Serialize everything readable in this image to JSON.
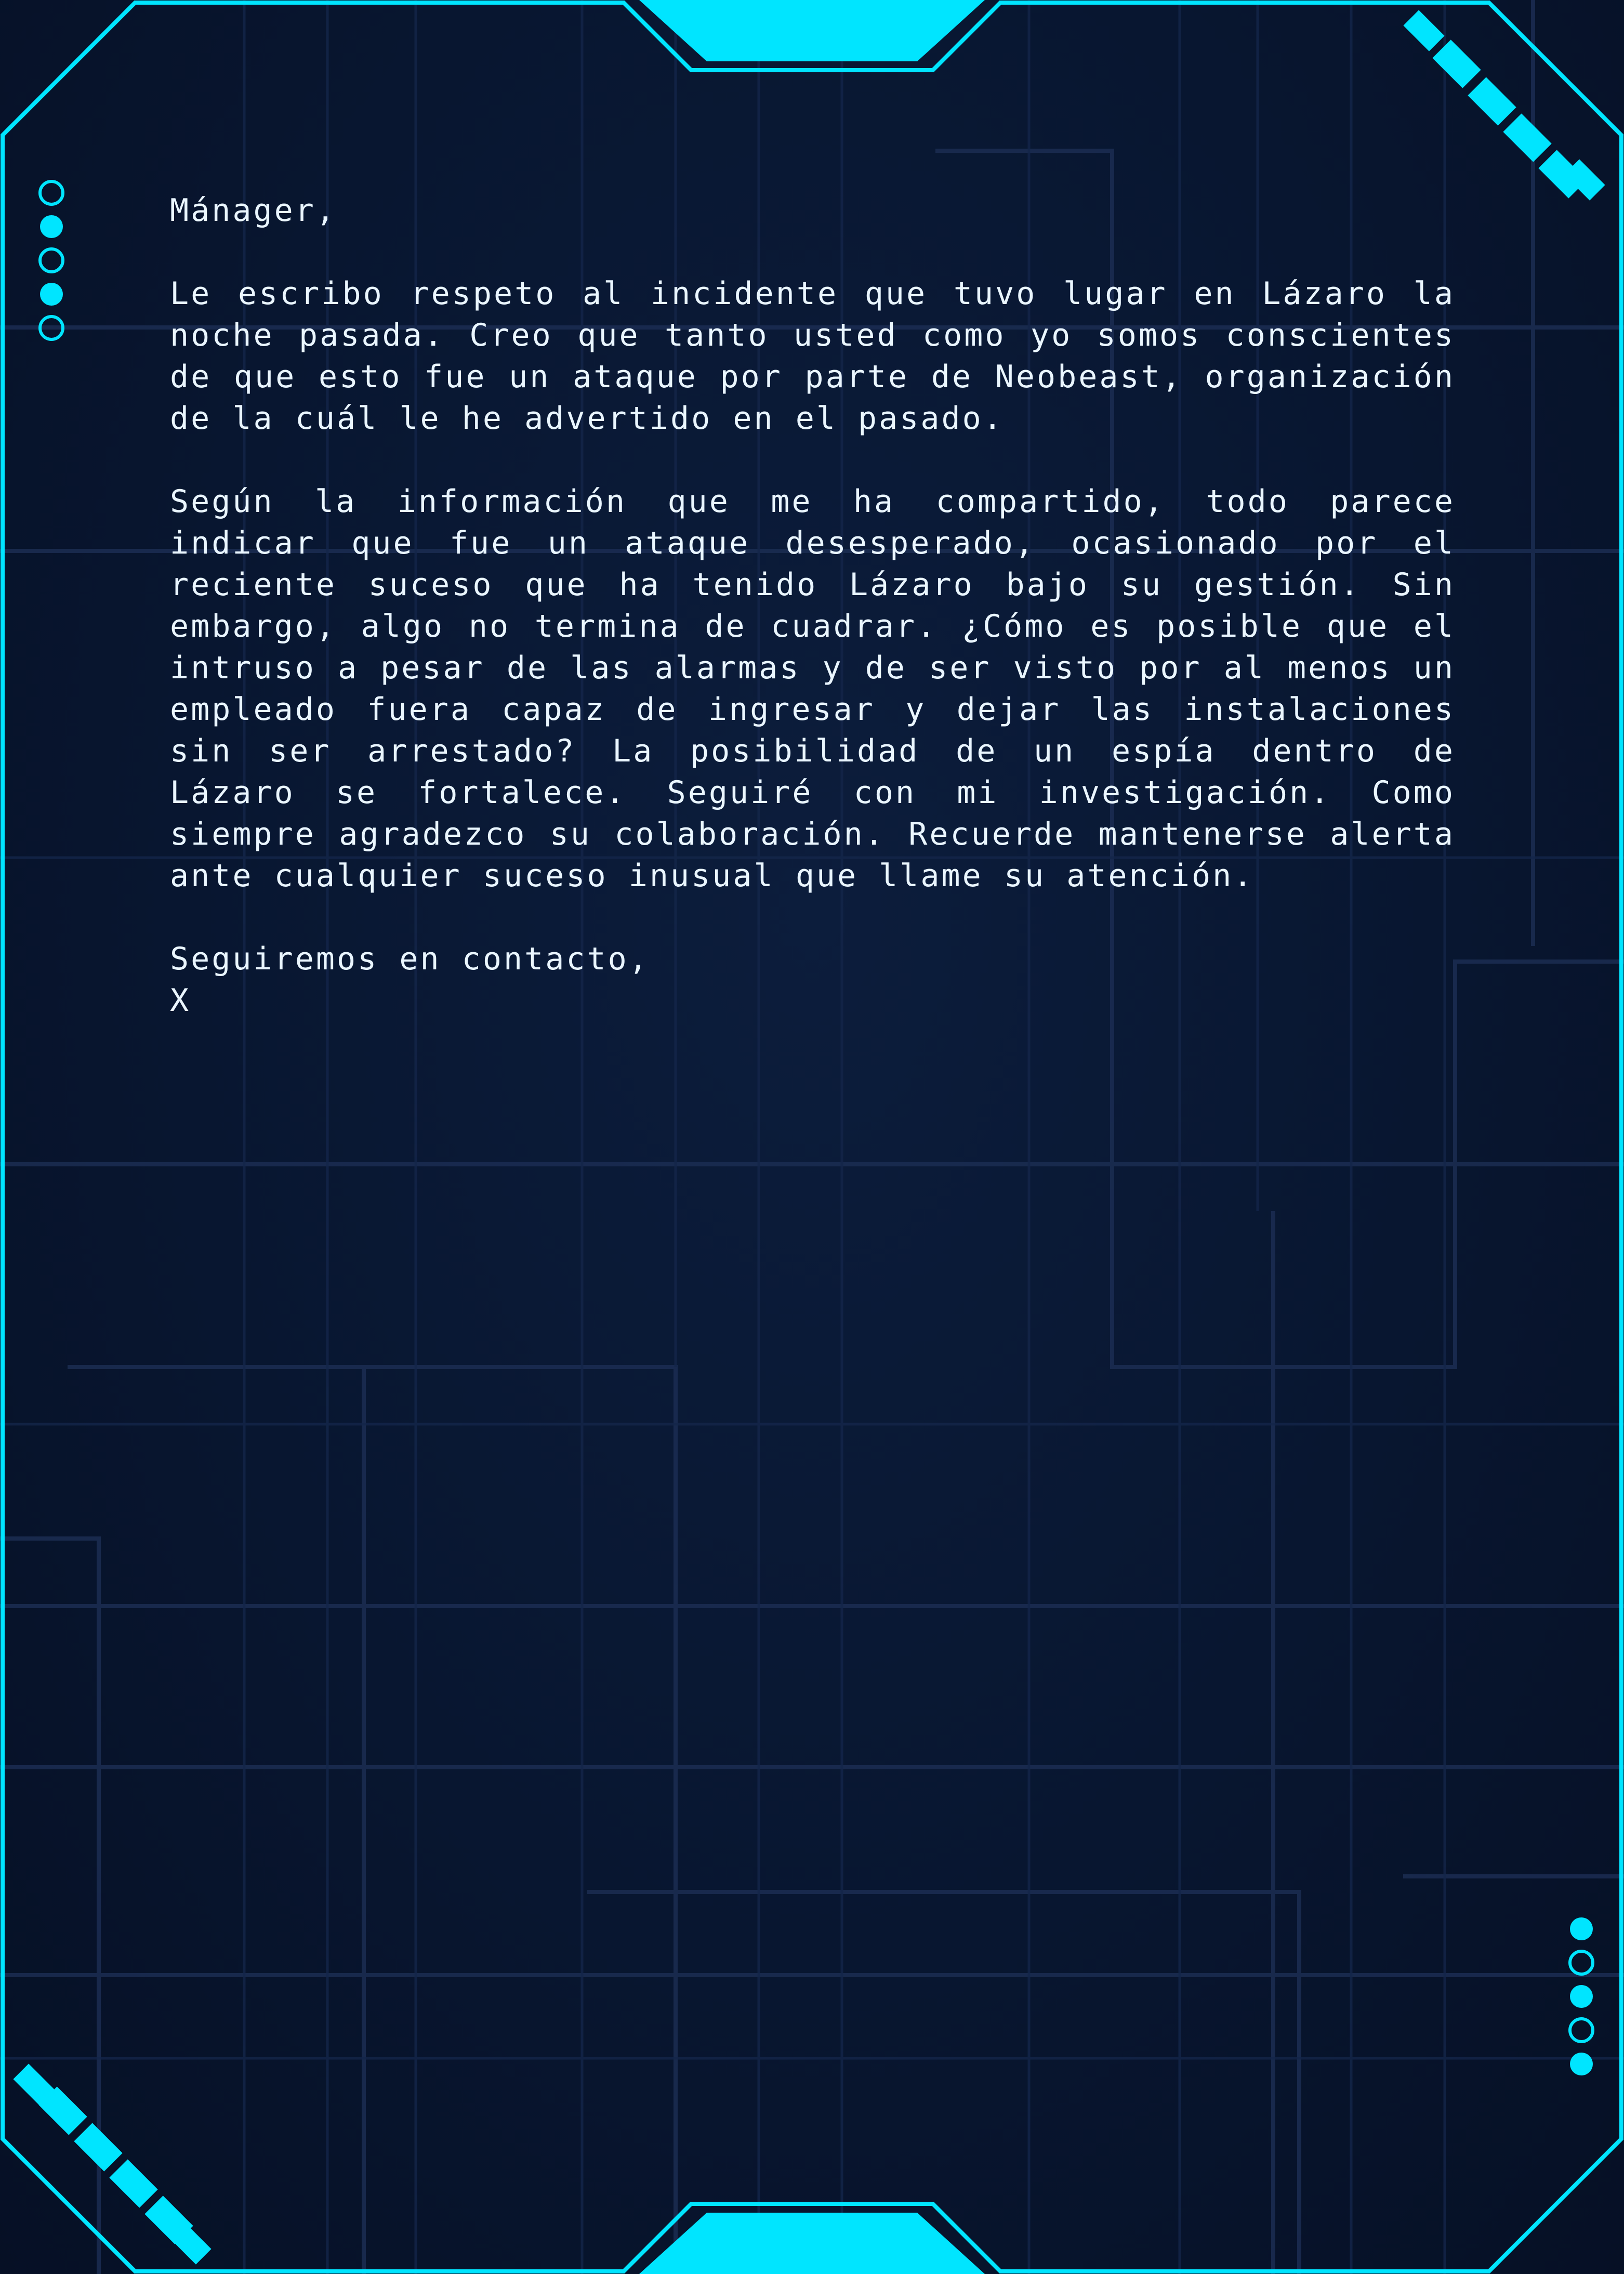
{
  "colors": {
    "accent": "#00e5ff",
    "background": "#081630",
    "text": "#eaf6ff",
    "circuit": "#1b2d52"
  },
  "letter": {
    "greeting": "Mánager,",
    "paragraphs": [
      "Le escribo respeto al incidente que tuvo lugar en Lázaro la noche pasada. Creo que tanto usted como yo somos conscientes de que esto fue un ataque por parte de Neobeast, organización de la cuál le he advertido en el pasado.",
      "Según la información que me ha compartido, todo parece indicar que fue un ataque desesperado, ocasionado por el reciente suceso que ha tenido Lázaro bajo su gestión. Sin embargo, algo no termina de cuadrar. ¿Cómo es posible que el intruso a pesar de las alarmas y de ser visto por al menos un empleado fuera capaz de ingresar y dejar las instalaciones sin ser arrestado? La posibilidad de un espía dentro de Lázaro se fortalece. Seguiré con mi investigación. Como siempre agradezco su colaboración. Recuerde mantenerse alerta ante cualquier suceso inusual que llame su atención."
    ],
    "closing": "Seguiremos en contacto,",
    "signature": "X"
  },
  "indicators": {
    "left": [
      "outline",
      "filled",
      "outline",
      "filled",
      "outline"
    ],
    "right": [
      "filled",
      "outline",
      "filled",
      "outline",
      "filled"
    ]
  }
}
